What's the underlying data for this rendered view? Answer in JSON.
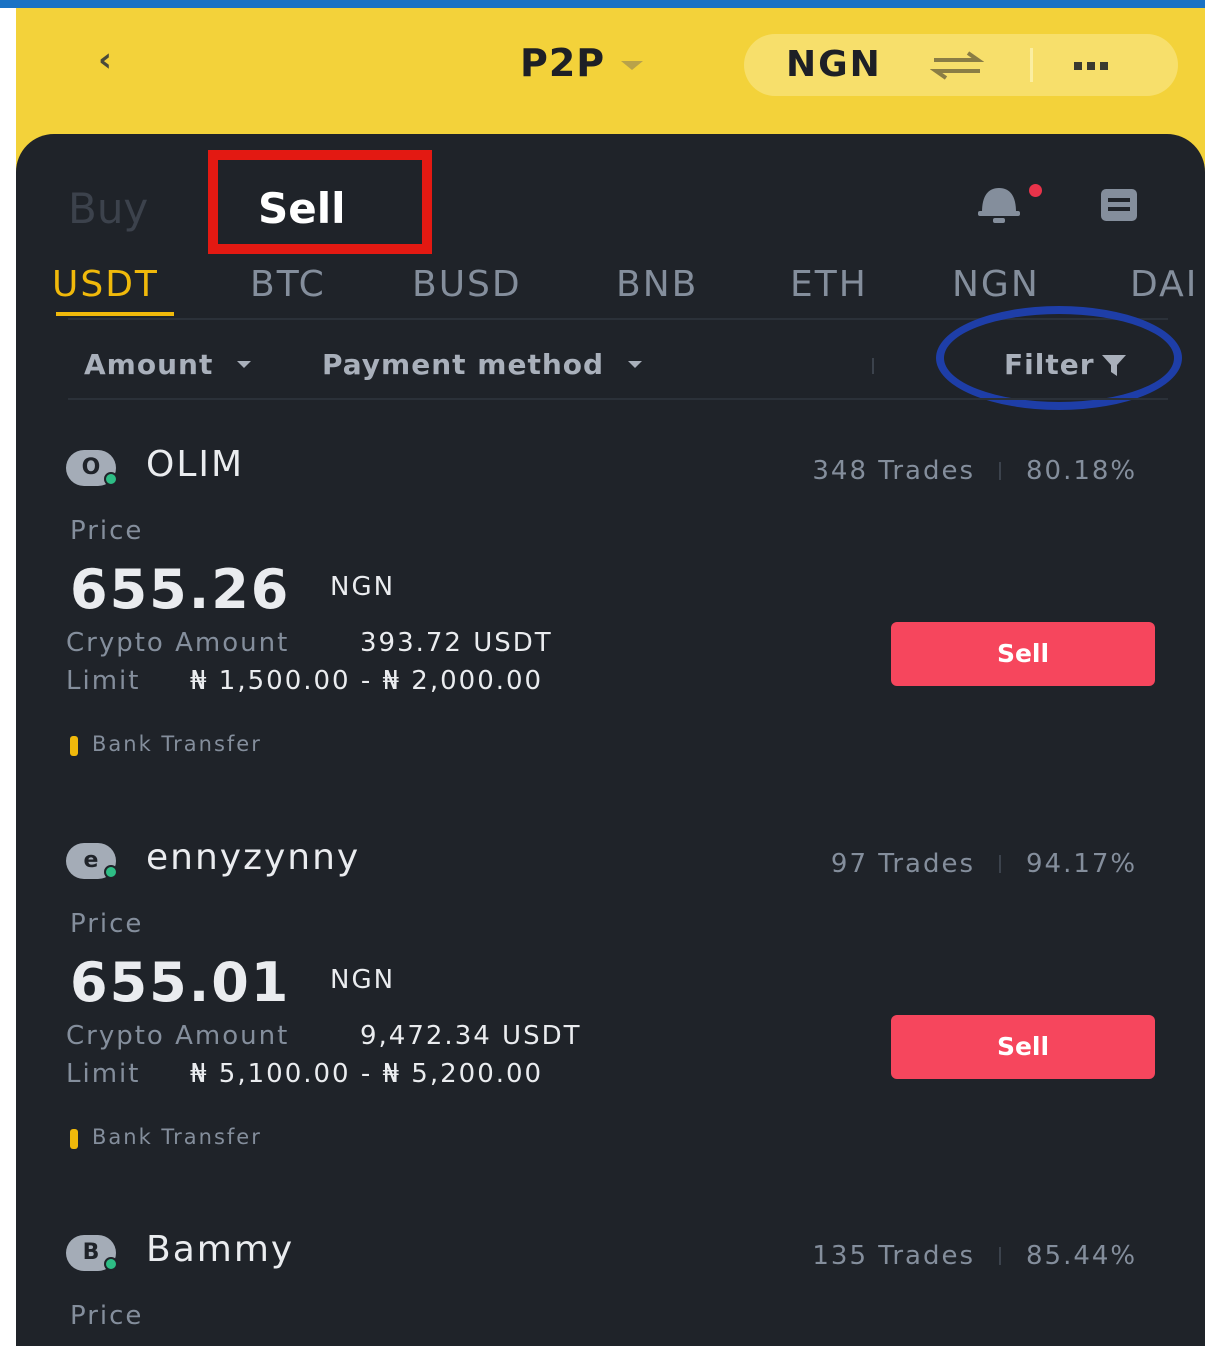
{
  "header": {
    "back_icon": "chevron-left-icon",
    "title": "P2P",
    "fiat_currency": "NGN",
    "swap_icon": "swap-arrows-icon",
    "more_icon": "more-dots-icon",
    "colors": {
      "header_bg": "#f3d23a",
      "panel_bg": "#1f2329"
    }
  },
  "side_tabs": {
    "buy": "Buy",
    "sell": "Sell",
    "active": "Sell"
  },
  "icons": {
    "notification": "bell-icon",
    "orders": "orders-icon"
  },
  "coin_tabs": [
    "USDT",
    "BTC",
    "BUSD",
    "BNB",
    "ETH",
    "NGN",
    "DAI"
  ],
  "active_coin": "USDT",
  "filters": {
    "amount": "Amount",
    "payment_method": "Payment method",
    "filter": "Filter"
  },
  "listings": [
    {
      "avatar_letter": "O",
      "name": "OLIM",
      "trades": "348 Trades",
      "completion": "80.18%",
      "price_label": "Price",
      "price": "655.26",
      "price_currency": "NGN",
      "crypto_label": "Crypto Amount",
      "crypto_amount": "393.72 USDT",
      "limit_label": "Limit",
      "limit": "₦ 1,500.00 - ₦ 2,000.00",
      "button": "Sell",
      "payment": "Bank Transfer"
    },
    {
      "avatar_letter": "e",
      "name": "ennyzynny",
      "trades": "97 Trades",
      "completion": "94.17%",
      "price_label": "Price",
      "price": "655.01",
      "price_currency": "NGN",
      "crypto_label": "Crypto Amount",
      "crypto_amount": "9,472.34 USDT",
      "limit_label": "Limit",
      "limit": "₦ 5,100.00 - ₦ 5,200.00",
      "button": "Sell",
      "payment": "Bank Transfer"
    },
    {
      "avatar_letter": "B",
      "name": "Bammy",
      "trades": "135 Trades",
      "completion": "85.44%",
      "price_label": "Price"
    }
  ]
}
